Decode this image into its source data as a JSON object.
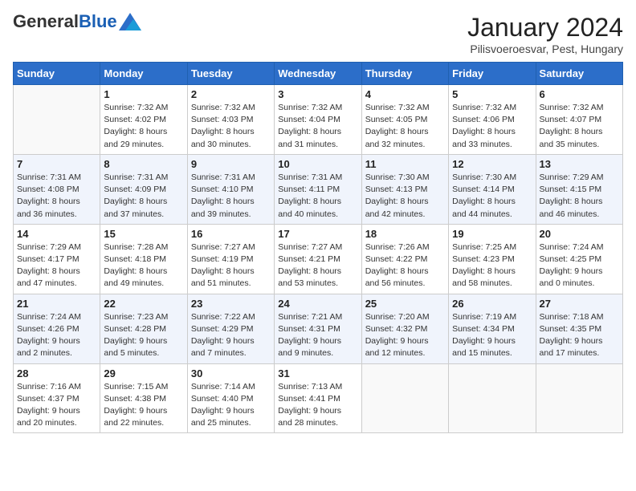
{
  "header": {
    "logo_general": "General",
    "logo_blue": "Blue",
    "month_title": "January 2024",
    "subtitle": "Pilisvoeroesvar, Pest, Hungary"
  },
  "days_of_week": [
    "Sunday",
    "Monday",
    "Tuesday",
    "Wednesday",
    "Thursday",
    "Friday",
    "Saturday"
  ],
  "weeks": [
    [
      {
        "day": "",
        "info": ""
      },
      {
        "day": "1",
        "info": "Sunrise: 7:32 AM\nSunset: 4:02 PM\nDaylight: 8 hours\nand 29 minutes."
      },
      {
        "day": "2",
        "info": "Sunrise: 7:32 AM\nSunset: 4:03 PM\nDaylight: 8 hours\nand 30 minutes."
      },
      {
        "day": "3",
        "info": "Sunrise: 7:32 AM\nSunset: 4:04 PM\nDaylight: 8 hours\nand 31 minutes."
      },
      {
        "day": "4",
        "info": "Sunrise: 7:32 AM\nSunset: 4:05 PM\nDaylight: 8 hours\nand 32 minutes."
      },
      {
        "day": "5",
        "info": "Sunrise: 7:32 AM\nSunset: 4:06 PM\nDaylight: 8 hours\nand 33 minutes."
      },
      {
        "day": "6",
        "info": "Sunrise: 7:32 AM\nSunset: 4:07 PM\nDaylight: 8 hours\nand 35 minutes."
      }
    ],
    [
      {
        "day": "7",
        "info": "Sunrise: 7:31 AM\nSunset: 4:08 PM\nDaylight: 8 hours\nand 36 minutes."
      },
      {
        "day": "8",
        "info": "Sunrise: 7:31 AM\nSunset: 4:09 PM\nDaylight: 8 hours\nand 37 minutes."
      },
      {
        "day": "9",
        "info": "Sunrise: 7:31 AM\nSunset: 4:10 PM\nDaylight: 8 hours\nand 39 minutes."
      },
      {
        "day": "10",
        "info": "Sunrise: 7:31 AM\nSunset: 4:11 PM\nDaylight: 8 hours\nand 40 minutes."
      },
      {
        "day": "11",
        "info": "Sunrise: 7:30 AM\nSunset: 4:13 PM\nDaylight: 8 hours\nand 42 minutes."
      },
      {
        "day": "12",
        "info": "Sunrise: 7:30 AM\nSunset: 4:14 PM\nDaylight: 8 hours\nand 44 minutes."
      },
      {
        "day": "13",
        "info": "Sunrise: 7:29 AM\nSunset: 4:15 PM\nDaylight: 8 hours\nand 46 minutes."
      }
    ],
    [
      {
        "day": "14",
        "info": "Sunrise: 7:29 AM\nSunset: 4:17 PM\nDaylight: 8 hours\nand 47 minutes."
      },
      {
        "day": "15",
        "info": "Sunrise: 7:28 AM\nSunset: 4:18 PM\nDaylight: 8 hours\nand 49 minutes."
      },
      {
        "day": "16",
        "info": "Sunrise: 7:27 AM\nSunset: 4:19 PM\nDaylight: 8 hours\nand 51 minutes."
      },
      {
        "day": "17",
        "info": "Sunrise: 7:27 AM\nSunset: 4:21 PM\nDaylight: 8 hours\nand 53 minutes."
      },
      {
        "day": "18",
        "info": "Sunrise: 7:26 AM\nSunset: 4:22 PM\nDaylight: 8 hours\nand 56 minutes."
      },
      {
        "day": "19",
        "info": "Sunrise: 7:25 AM\nSunset: 4:23 PM\nDaylight: 8 hours\nand 58 minutes."
      },
      {
        "day": "20",
        "info": "Sunrise: 7:24 AM\nSunset: 4:25 PM\nDaylight: 9 hours\nand 0 minutes."
      }
    ],
    [
      {
        "day": "21",
        "info": "Sunrise: 7:24 AM\nSunset: 4:26 PM\nDaylight: 9 hours\nand 2 minutes."
      },
      {
        "day": "22",
        "info": "Sunrise: 7:23 AM\nSunset: 4:28 PM\nDaylight: 9 hours\nand 5 minutes."
      },
      {
        "day": "23",
        "info": "Sunrise: 7:22 AM\nSunset: 4:29 PM\nDaylight: 9 hours\nand 7 minutes."
      },
      {
        "day": "24",
        "info": "Sunrise: 7:21 AM\nSunset: 4:31 PM\nDaylight: 9 hours\nand 9 minutes."
      },
      {
        "day": "25",
        "info": "Sunrise: 7:20 AM\nSunset: 4:32 PM\nDaylight: 9 hours\nand 12 minutes."
      },
      {
        "day": "26",
        "info": "Sunrise: 7:19 AM\nSunset: 4:34 PM\nDaylight: 9 hours\nand 15 minutes."
      },
      {
        "day": "27",
        "info": "Sunrise: 7:18 AM\nSunset: 4:35 PM\nDaylight: 9 hours\nand 17 minutes."
      }
    ],
    [
      {
        "day": "28",
        "info": "Sunrise: 7:16 AM\nSunset: 4:37 PM\nDaylight: 9 hours\nand 20 minutes."
      },
      {
        "day": "29",
        "info": "Sunrise: 7:15 AM\nSunset: 4:38 PM\nDaylight: 9 hours\nand 22 minutes."
      },
      {
        "day": "30",
        "info": "Sunrise: 7:14 AM\nSunset: 4:40 PM\nDaylight: 9 hours\nand 25 minutes."
      },
      {
        "day": "31",
        "info": "Sunrise: 7:13 AM\nSunset: 4:41 PM\nDaylight: 9 hours\nand 28 minutes."
      },
      {
        "day": "",
        "info": ""
      },
      {
        "day": "",
        "info": ""
      },
      {
        "day": "",
        "info": ""
      }
    ]
  ]
}
